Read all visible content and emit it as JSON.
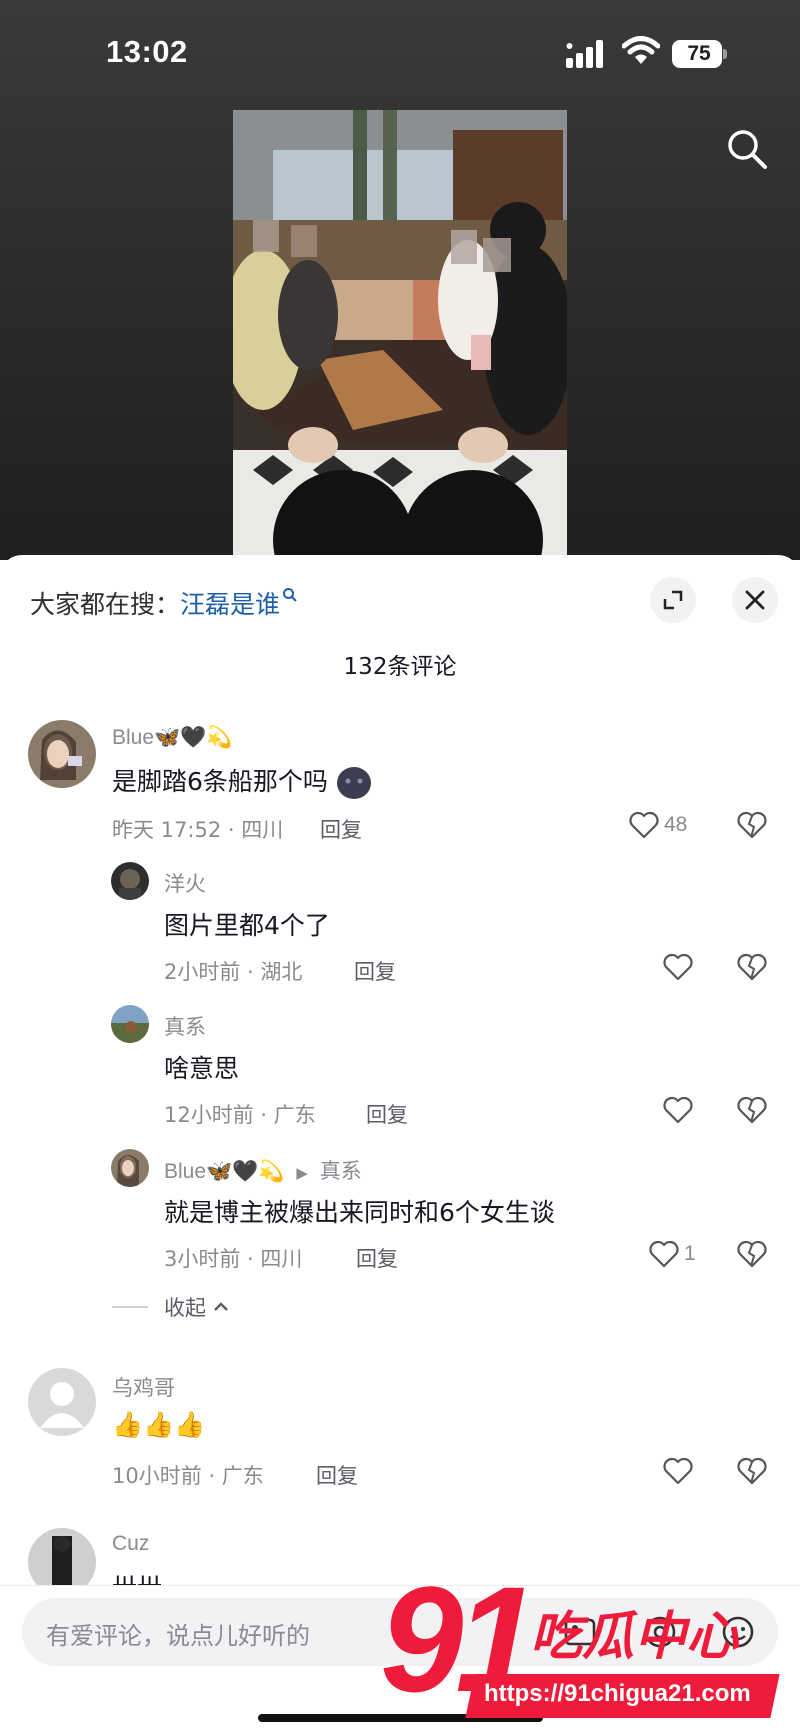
{
  "status_bar": {
    "time": "13:02",
    "battery": "75"
  },
  "hot_search": {
    "prefix": "大家都在搜：",
    "query": "汪磊是谁"
  },
  "comment_count": "132条评论",
  "comments": [
    {
      "name": "Blue🦋🖤💫",
      "text": "是脚踏6条船那个吗",
      "meta": "昨天 17:52 · 四川",
      "reply": "回复",
      "likes": "48"
    },
    {
      "name": "洋火",
      "text": "图片里都4个了",
      "meta": "2小时前 · 湖北",
      "reply": "回复",
      "likes": ""
    },
    {
      "name": "真系",
      "text": "啥意思",
      "meta": "12小时前 · 广东",
      "reply": "回复",
      "likes": ""
    },
    {
      "name": "Blue🦋🖤💫",
      "reply_to": "真系",
      "text": "就是博主被爆出来同时和6个女生谈",
      "meta": "3小时前 · 四川",
      "reply": "回复",
      "likes": "1"
    },
    {
      "name": "乌鸡哥",
      "text": "👍👍👍",
      "meta": "10小时前 · 广东",
      "reply": "回复",
      "likes": ""
    },
    {
      "name": "Cuz",
      "text": "卅卅"
    }
  ],
  "collapse_label": "收起",
  "input": {
    "placeholder": "有爱评论，说点儿好听的"
  },
  "watermark": {
    "number": "91",
    "brand": "吃瓜中心",
    "url": "https://91chigua21.com"
  },
  "colors": {
    "link": "#1f5fa8",
    "watermark": "#ee1c3a"
  }
}
